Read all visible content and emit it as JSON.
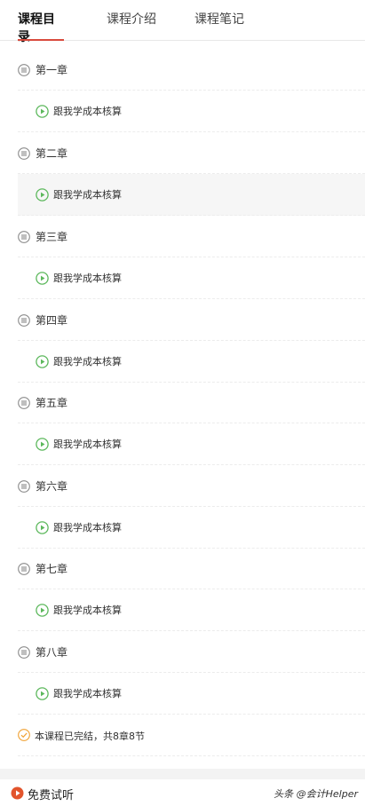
{
  "tabs": [
    {
      "label": "课程目录",
      "active": true
    },
    {
      "label": "课程介绍",
      "active": false
    },
    {
      "label": "课程笔记",
      "active": false
    }
  ],
  "chapters": [
    {
      "title": "第一章",
      "lesson": "跟我学成本核算"
    },
    {
      "title": "第二章",
      "lesson": "跟我学成本核算",
      "highlighted": true
    },
    {
      "title": "第三章",
      "lesson": "跟我学成本核算"
    },
    {
      "title": "第四章",
      "lesson": "跟我学成本核算"
    },
    {
      "title": "第五章",
      "lesson": "跟我学成本核算"
    },
    {
      "title": "第六章",
      "lesson": "跟我学成本核算"
    },
    {
      "title": "第七章",
      "lesson": "跟我学成本核算"
    },
    {
      "title": "第八章",
      "lesson": "跟我学成本核算"
    }
  ],
  "summary": {
    "text": "本课程已完结，共8章8节"
  },
  "bottom": {
    "trial_label": "免费试听",
    "watermark": "头条 @会计Helper"
  },
  "icons": {
    "chapter": "list-icon",
    "lesson": "play-circle-icon",
    "summary": "check-circle-icon",
    "trial": "play-circle-filled-icon"
  },
  "colors": {
    "accent": "#d94a3d",
    "play_green": "#5cb85c",
    "check_orange": "#f0a030",
    "icon_gray": "#8a8a8a"
  }
}
